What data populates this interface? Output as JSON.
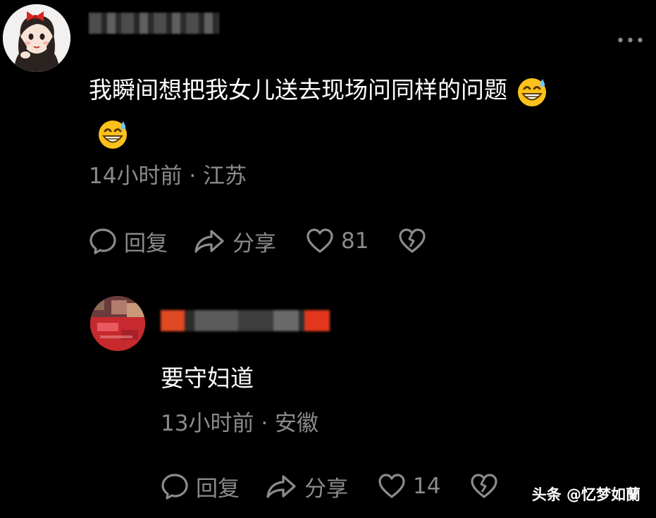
{
  "comment": {
    "text": "我瞬间想把我女儿送去现场问同样的问题",
    "emoji": "grinning-face-with-sweat-emoji",
    "time": "14小时前",
    "separator": "·",
    "location": "江苏",
    "more_icon": "more-dots-icon",
    "actions": {
      "reply_label": "回复",
      "share_label": "分享",
      "like_count": "81"
    }
  },
  "reply": {
    "text": "要守妇道",
    "time": "13小时前",
    "separator": "·",
    "location": "安徽",
    "actions": {
      "reply_label": "回复",
      "share_label": "分享",
      "like_count": "14"
    }
  },
  "watermark": "头条 @忆梦如蘭",
  "colors": {
    "background": "#000000",
    "text": "#ffffff",
    "secondary_text": "#8b8b8b"
  }
}
